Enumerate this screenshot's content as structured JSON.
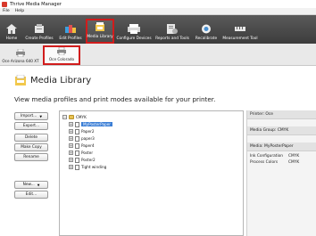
{
  "window": {
    "title": "Thrive Media Manager"
  },
  "menu": [
    "File",
    "Help"
  ],
  "toolbar": {
    "buttons": [
      {
        "label": "Home",
        "icon": "home-icon"
      },
      {
        "label": "Create Profiles",
        "icon": "create-profiles-icon"
      },
      {
        "label": "Edit Profiles",
        "icon": "edit-profiles-icon"
      },
      {
        "label": "Media Library",
        "icon": "media-library-icon",
        "active": true
      },
      {
        "label": "Configure Devices",
        "icon": "printer-icon"
      },
      {
        "label": "Reports and Tools",
        "icon": "reports-icon"
      },
      {
        "label": "Recalibrate",
        "icon": "recalibrate-icon"
      },
      {
        "label": "Measurement Tool",
        "icon": "measurement-icon"
      }
    ]
  },
  "printers": [
    {
      "label": "Oce Arizona 640 XT",
      "icon": "printer-icon"
    },
    {
      "label": "Oce Colorado",
      "icon": "printer-icon",
      "active": true
    }
  ],
  "page": {
    "title": "Media Library",
    "subtitle": "View media profiles and print modes available for your printer."
  },
  "actions": {
    "import": "Import...",
    "export": "Export...",
    "delete": "Delete",
    "make_copy": "Make Copy",
    "rename": "Rename",
    "new": "New...",
    "edit": "Edit..."
  },
  "tree": {
    "root": "CMYK",
    "items": [
      "MyPosterPaper",
      "Paper2",
      "paper3",
      "Paper4",
      "Poster",
      "Poster2",
      "Tight winding"
    ],
    "selected_index": 0
  },
  "details": {
    "printer_label": "Printer: Oce",
    "media_group_label": "Media Group: CMYK",
    "media_label": "Media: MyPosterPaper",
    "ink_configuration_label": "Ink Configuration",
    "ink_configuration_value": "CMYK",
    "process_colors_label": "Process Colors",
    "process_colors_value": "CMYK"
  },
  "colors": {
    "toolbar_bg": "#4a4a4a",
    "highlight_border": "#d11c1c",
    "selection": "#3c7fd6"
  }
}
